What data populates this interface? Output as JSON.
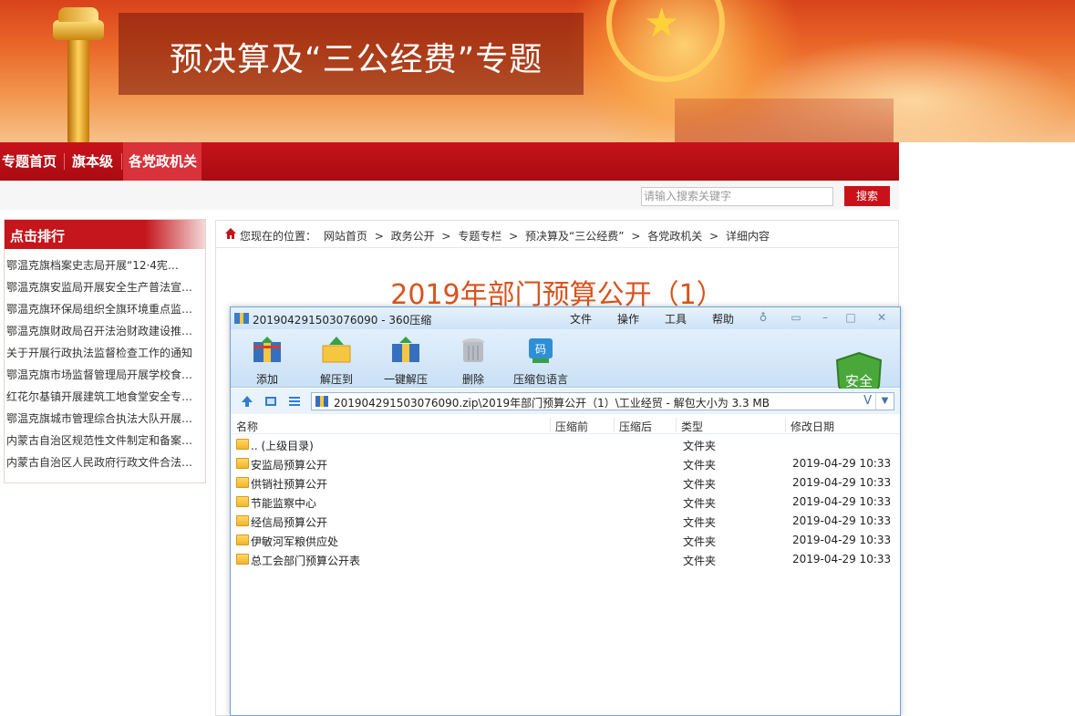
{
  "banner": {
    "title": "预决算及“三公经费”专题"
  },
  "nav": {
    "items": [
      "专题首页",
      "旗本级",
      "各党政机关"
    ]
  },
  "search": {
    "placeholder": "请输入搜索关键字",
    "button": "搜索"
  },
  "sidebar": {
    "heading": "点击排行",
    "items": [
      "鄂温克旗档案史志局开展“12·4宪…",
      "鄂温克旗安监局开展安全生产普法宣…",
      "鄂温克旗环保局组织全旗环境重点监…",
      "鄂温克旗财政局召开法治财政建设推…",
      "关于开展行政执法监督检查工作的通知",
      "鄂温克旗市场监督管理局开展学校食…",
      "红花尔基镇开展建筑工地食堂安全专…",
      "鄂温克旗城市管理综合执法大队开展…",
      "内蒙古自治区规范性文件制定和备案…",
      "内蒙古自治区人民政府行政文件合法…"
    ]
  },
  "breadcrumb": {
    "prefix": "您现在的位置：",
    "items": [
      "网站首页",
      "政务公开",
      "专题专栏",
      "预决算及“三公经费”",
      "各党政机关",
      "详细内容"
    ],
    "separator": ">"
  },
  "article": {
    "title": "2019年部门预算公开（1）"
  },
  "zip": {
    "title": "201904291503076090 - 360压缩",
    "menus": [
      "文件",
      "操作",
      "工具",
      "帮助"
    ],
    "toolbar": [
      "添加",
      "解压到",
      "一键解压",
      "删除",
      "压缩包语言"
    ],
    "shield_label": "安全",
    "path": "201904291503076090.zip\\2019年部门预算公开（1）\\工业经贸 - 解包大小为 3.3 MB",
    "path_v": "V",
    "columns": [
      "名称",
      "压缩前",
      "压缩后",
      "类型",
      "修改日期"
    ],
    "rows": [
      {
        "name": ".. (上级目录)",
        "type": "文件夹",
        "date": ""
      },
      {
        "name": "安监局预算公开",
        "type": "文件夹",
        "date": "2019-04-29 10:33"
      },
      {
        "name": "供销社预算公开",
        "type": "文件夹",
        "date": "2019-04-29 10:33"
      },
      {
        "name": "节能监察中心",
        "type": "文件夹",
        "date": "2019-04-29 10:33"
      },
      {
        "name": "经信局预算公开",
        "type": "文件夹",
        "date": "2019-04-29 10:33"
      },
      {
        "name": "伊敏河军粮供应处",
        "type": "文件夹",
        "date": "2019-04-29 10:33"
      },
      {
        "name": "总工会部门预算公开表",
        "type": "文件夹",
        "date": "2019-04-29 10:33"
      }
    ]
  },
  "colors": {
    "brand_red": "#c8121a",
    "title_orange": "#d9531e",
    "window_blue": "#6fa2d8"
  }
}
